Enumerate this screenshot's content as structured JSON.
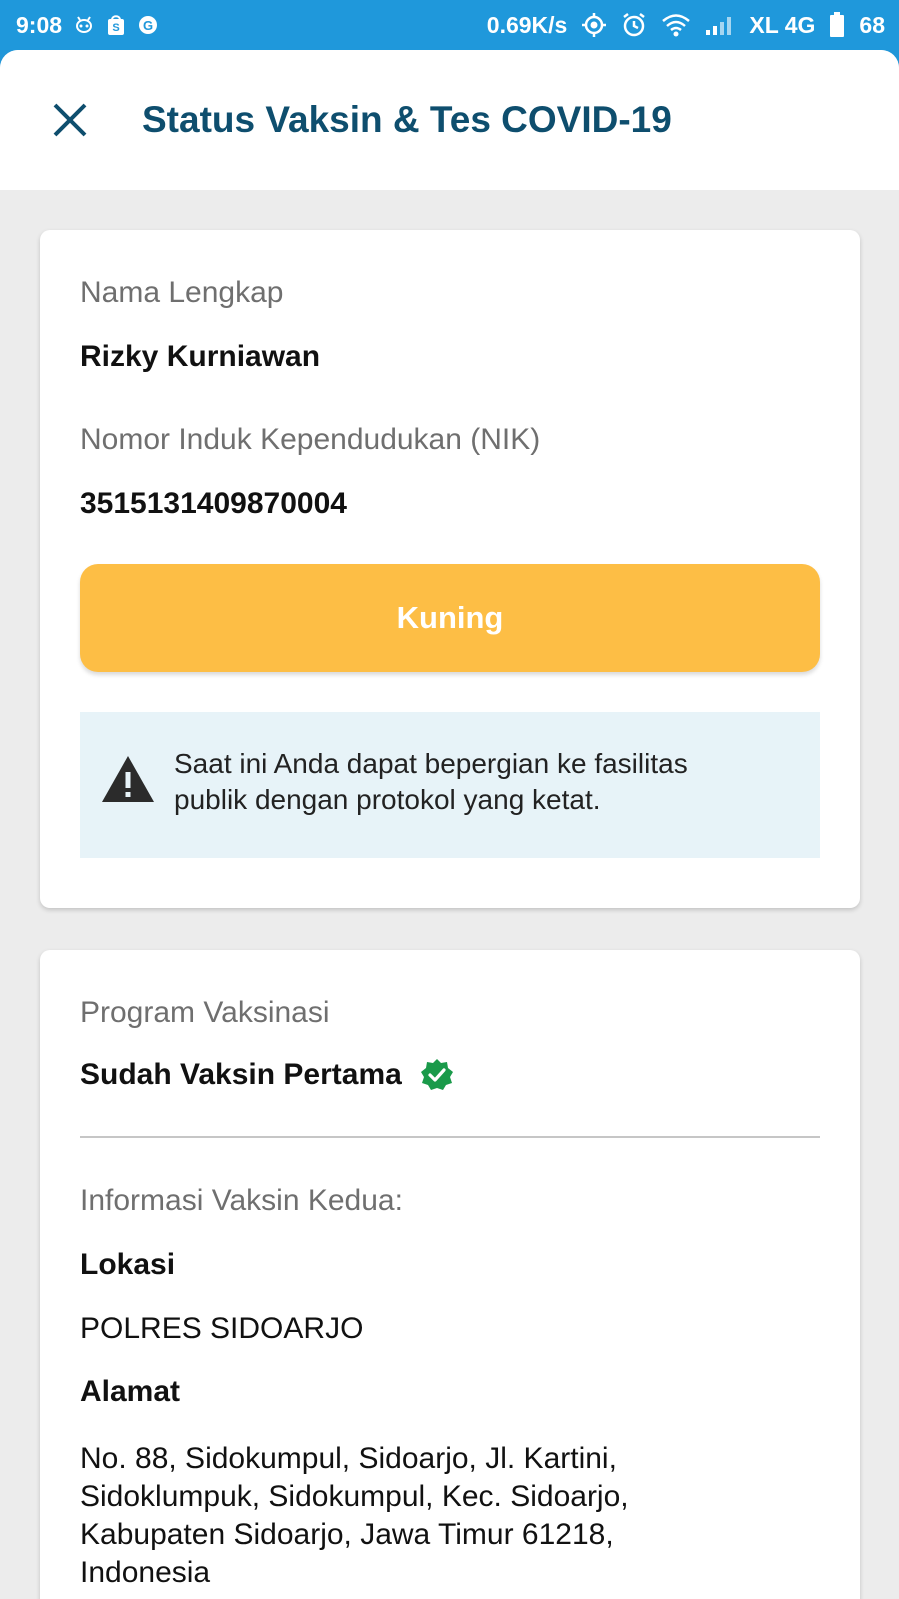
{
  "statusbar": {
    "time": "9:08",
    "net_speed": "0.69K/s",
    "carrier": "XL 4G",
    "battery": "68",
    "icons": [
      "alien-icon",
      "shopee-icon",
      "google-icon",
      "location-icon",
      "alarm-icon",
      "wifi-icon",
      "signal-icon",
      "battery-icon"
    ]
  },
  "header": {
    "title": "Status Vaksin & Tes COVID-19",
    "close_icon": "close-icon"
  },
  "identity": {
    "name_label": "Nama Lengkap",
    "name_value": "Rizky Kurniawan",
    "nik_label": "Nomor Induk Kependudukan (NIK)",
    "nik_value": "3515131409870004",
    "status_label": "Kuning",
    "status_color": "#fdbe45",
    "notice_icon": "warning-icon",
    "notice_text_line1": "Saat ini Anda dapat bepergian ke fasilitas",
    "notice_text_line2": "publik dengan protokol yang ketat."
  },
  "vaccine": {
    "program_label": "Program Vaksinasi",
    "program_value": "Sudah Vaksin Pertama",
    "verified_icon": "verified-badge-icon",
    "verified_color": "#1a9a4a",
    "second_info_label": "Informasi Vaksin Kedua:",
    "location_label": "Lokasi",
    "location_value": "POLRES SIDOARJO",
    "address_label": "Alamat",
    "address_line1": "No. 88, Sidokumpul, Sidoarjo, Jl. Kartini,",
    "address_line2": "Sidoklumpuk, Sidokumpul, Kec. Sidoarjo,",
    "address_line3": "Kabupaten Sidoarjo, Jawa Timur 61218,",
    "address_line4": "Indonesia"
  }
}
